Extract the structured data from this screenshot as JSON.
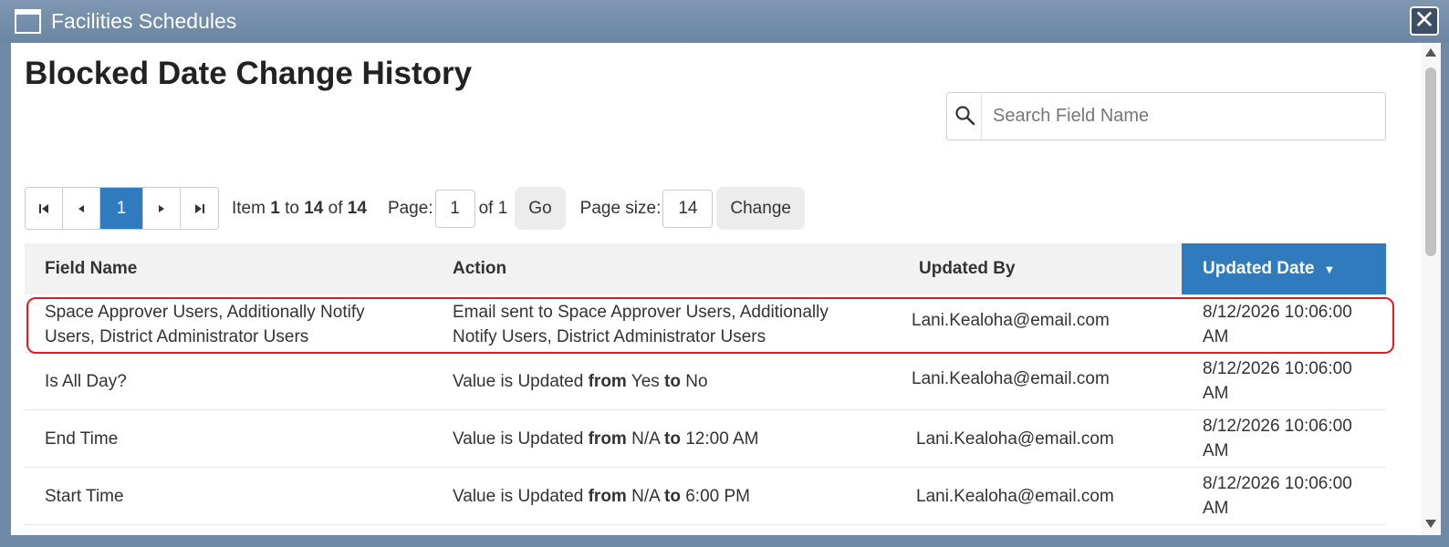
{
  "window": {
    "title": "Facilities Schedules",
    "close_glyph": "✕"
  },
  "page": {
    "title": "Blocked Date Change History"
  },
  "search": {
    "placeholder": "Search Field Name",
    "value": ""
  },
  "pager": {
    "current_page": "1",
    "item_label": "Item",
    "item_from": "1",
    "to_label": "to",
    "item_to": "14",
    "of_label": "of",
    "item_total": "14",
    "page_label": "Page:",
    "page_value": "1",
    "page_of": "of 1",
    "go_label": "Go",
    "size_label": "Page size:",
    "size_value": "14",
    "change_label": "Change"
  },
  "grid": {
    "columns": [
      "Field Name",
      "Action",
      "Updated By",
      "Updated Date"
    ],
    "sorted_column": "Updated Date",
    "sort_direction": "descending",
    "rows": [
      {
        "field": "Space Approver Users, Additionally Notify Users, District Administrator Users",
        "action": "Email sent to Space Approver Users, Additionally Notify Users, District Administrator Users",
        "user": "Lani.Kealoha@email.com",
        "date": "8/12/2026 10:06:00 AM"
      },
      {
        "field": "Is All Day?",
        "action_prefix": "Value is Updated",
        "from_word": "from",
        "from_value": "Yes",
        "to_word": "to",
        "to_value": "No",
        "user": "Lani.Kealoha@email.com",
        "date": "8/12/2026 10:06:00 AM"
      },
      {
        "field": "End Time",
        "action_prefix": "Value is Updated",
        "from_word": "from",
        "from_value": "N/A",
        "to_word": "to",
        "to_value": "12:00 AM",
        "user": "Lani.Kealoha@email.com",
        "date": "8/12/2026 10:06:00 AM"
      },
      {
        "field": "Start Time",
        "action_prefix": "Value is Updated",
        "from_word": "from",
        "from_value": "N/A",
        "to_word": "to",
        "to_value": "6:00 PM",
        "user": "Lani.Kealoha@email.com",
        "date": "8/12/2026 10:06:00 AM"
      }
    ]
  },
  "colors": {
    "titlebar": "#6f8aa6",
    "accent": "#2f7bbd",
    "highlight": "#e01b24"
  }
}
